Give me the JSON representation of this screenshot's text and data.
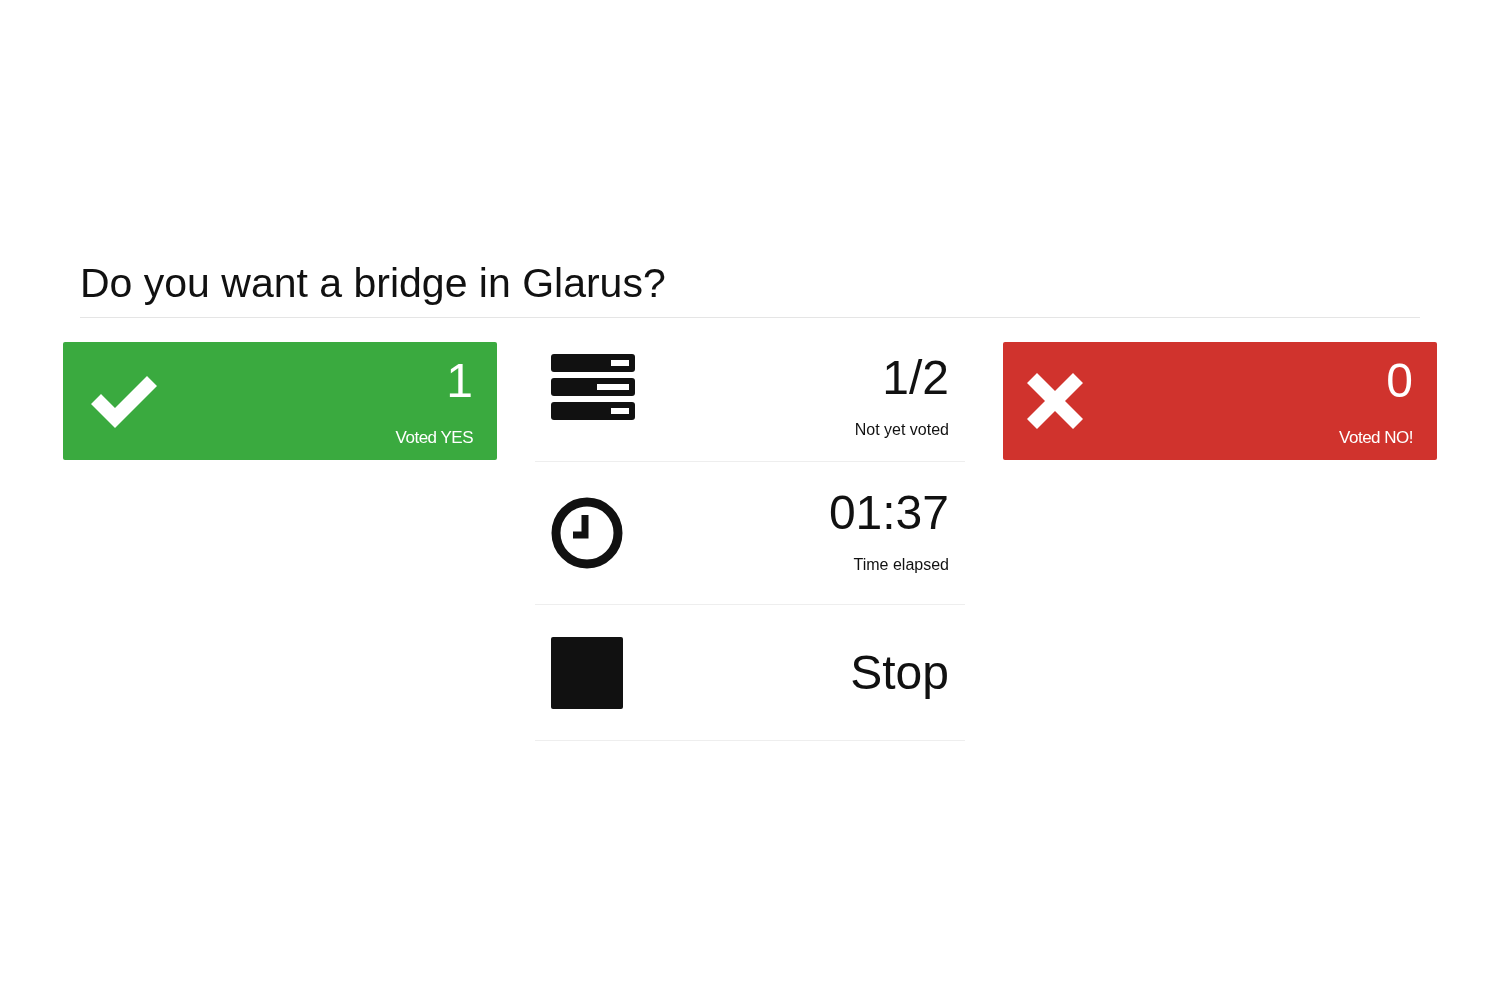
{
  "question": "Do you want a bridge in Glarus?",
  "tallies": [
    {
      "kind": "yes",
      "count": "1",
      "label": "Voted YES"
    },
    {
      "kind": "no",
      "count": "0",
      "label": "Voted NO!"
    }
  ],
  "stats": [
    {
      "kind": "pending",
      "value": "1/2",
      "label": "Not yet voted"
    },
    {
      "kind": "timer",
      "value": "01:37",
      "label": "Time elapsed"
    },
    {
      "kind": "stop",
      "value": "Stop"
    }
  ]
}
